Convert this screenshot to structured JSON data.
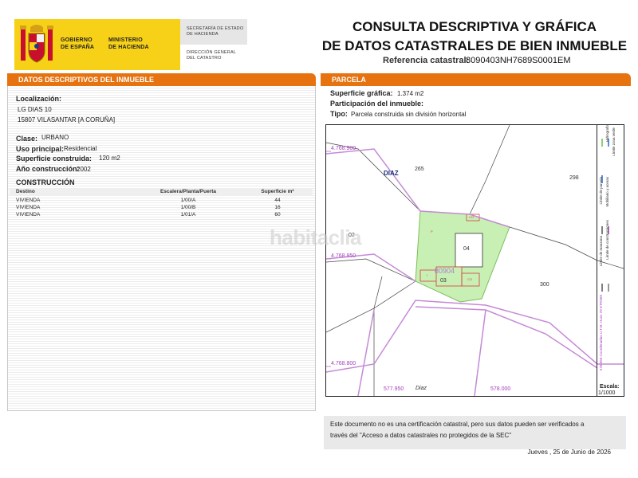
{
  "header": {
    "gov_line1": "GOBIERNO",
    "gov_line2": "DE ESPAÑA",
    "min_line1": "MINISTERIO",
    "min_line2": "DE HACIENDA",
    "sec_line1": "SECRETARÍA DE ESTADO",
    "sec_line2": "DE HACIENDA",
    "dir_line1": "DIRECCIÓN GENERAL",
    "dir_line2": "DEL CATASTRO",
    "title_line1": "CONSULTA DESCRIPTIVA Y GRÁFICA",
    "title_line2": "DE DATOS CATASTRALES DE BIEN INMUEBLE",
    "ref_label": "Referencia catastral:",
    "ref_value": "8090403NH7689S0001EM"
  },
  "left": {
    "bar_title": "DATOS DESCRIPTIVOS DEL INMUEBLE",
    "localizacion_label": "Localización:",
    "address_line1": "LG DIAS 10",
    "address_line2": "15807 VILASANTAR [A CORUÑA]",
    "clase_label": "Clase:",
    "clase_value": "URBANO",
    "uso_label": "Uso principal:",
    "uso_value": "Residencial",
    "sup_label": "Superficie construida:",
    "sup_value": "120 m2",
    "anio_label": "Año construcción:",
    "anio_value": "2002",
    "construccion_label": "CONSTRUCCIÓN",
    "table_headers": [
      "Destino",
      "Escalera/Planta/Puerta",
      "Superficie m²"
    ],
    "rows": [
      [
        "VIVIENDA",
        "1/00/A",
        "44"
      ],
      [
        "VIVIENDA",
        "1/00/B",
        "16"
      ],
      [
        "VIVIENDA",
        "1/01/A",
        "60"
      ]
    ]
  },
  "right": {
    "bar_title": "PARCELA",
    "sup_grafica_label": "Superficie gráfica:",
    "sup_grafica_value": "1.374 m2",
    "participacion_label": "Participación del inmueble:",
    "tipo_label": "Tipo:",
    "tipo_value": "Parcela construida sin división horizontal"
  },
  "map": {
    "y_labels": [
      "4.768.900",
      "4.768.850",
      "4.768.800"
    ],
    "x_labels": [
      "577.950",
      "578.000"
    ],
    "place_label": "DIAZ",
    "street_label": "Diaz",
    "parcel_numbers": [
      "265",
      "298",
      "02",
      "04",
      "03",
      "300"
    ],
    "parcel_ref": "80904",
    "small_codes": [
      "P",
      "CO",
      "CO",
      "I"
    ],
    "escala_label": "Escala:",
    "escala_value": "1/1000",
    "legend_items": [
      "Límite zona verde",
      "Hidrografía",
      "Límite de parcela",
      "Mobiliario y aceras",
      "Límite de manzana",
      "Límite de construcciones"
    ],
    "coords_note": "578.050 Coordenadas U.T.M. Huso 29 ETRS89"
  },
  "watermark": "habitaclia",
  "notice": {
    "line1": "Este documento no es una certificación catastral, pero sus datos pueden ser verificados a",
    "line2": "través del \"Acceso a datos catastrales no protegidos de la SEC\""
  },
  "date": "Jueves , 25 de Junio de 2026",
  "colors": {
    "orange_bar": "#e6730f",
    "gov_yellow": "#f7d117",
    "parcel_green": "#c9f0b4",
    "boundary_purple": "#c58ad6",
    "building_red": "#d23c3c"
  }
}
